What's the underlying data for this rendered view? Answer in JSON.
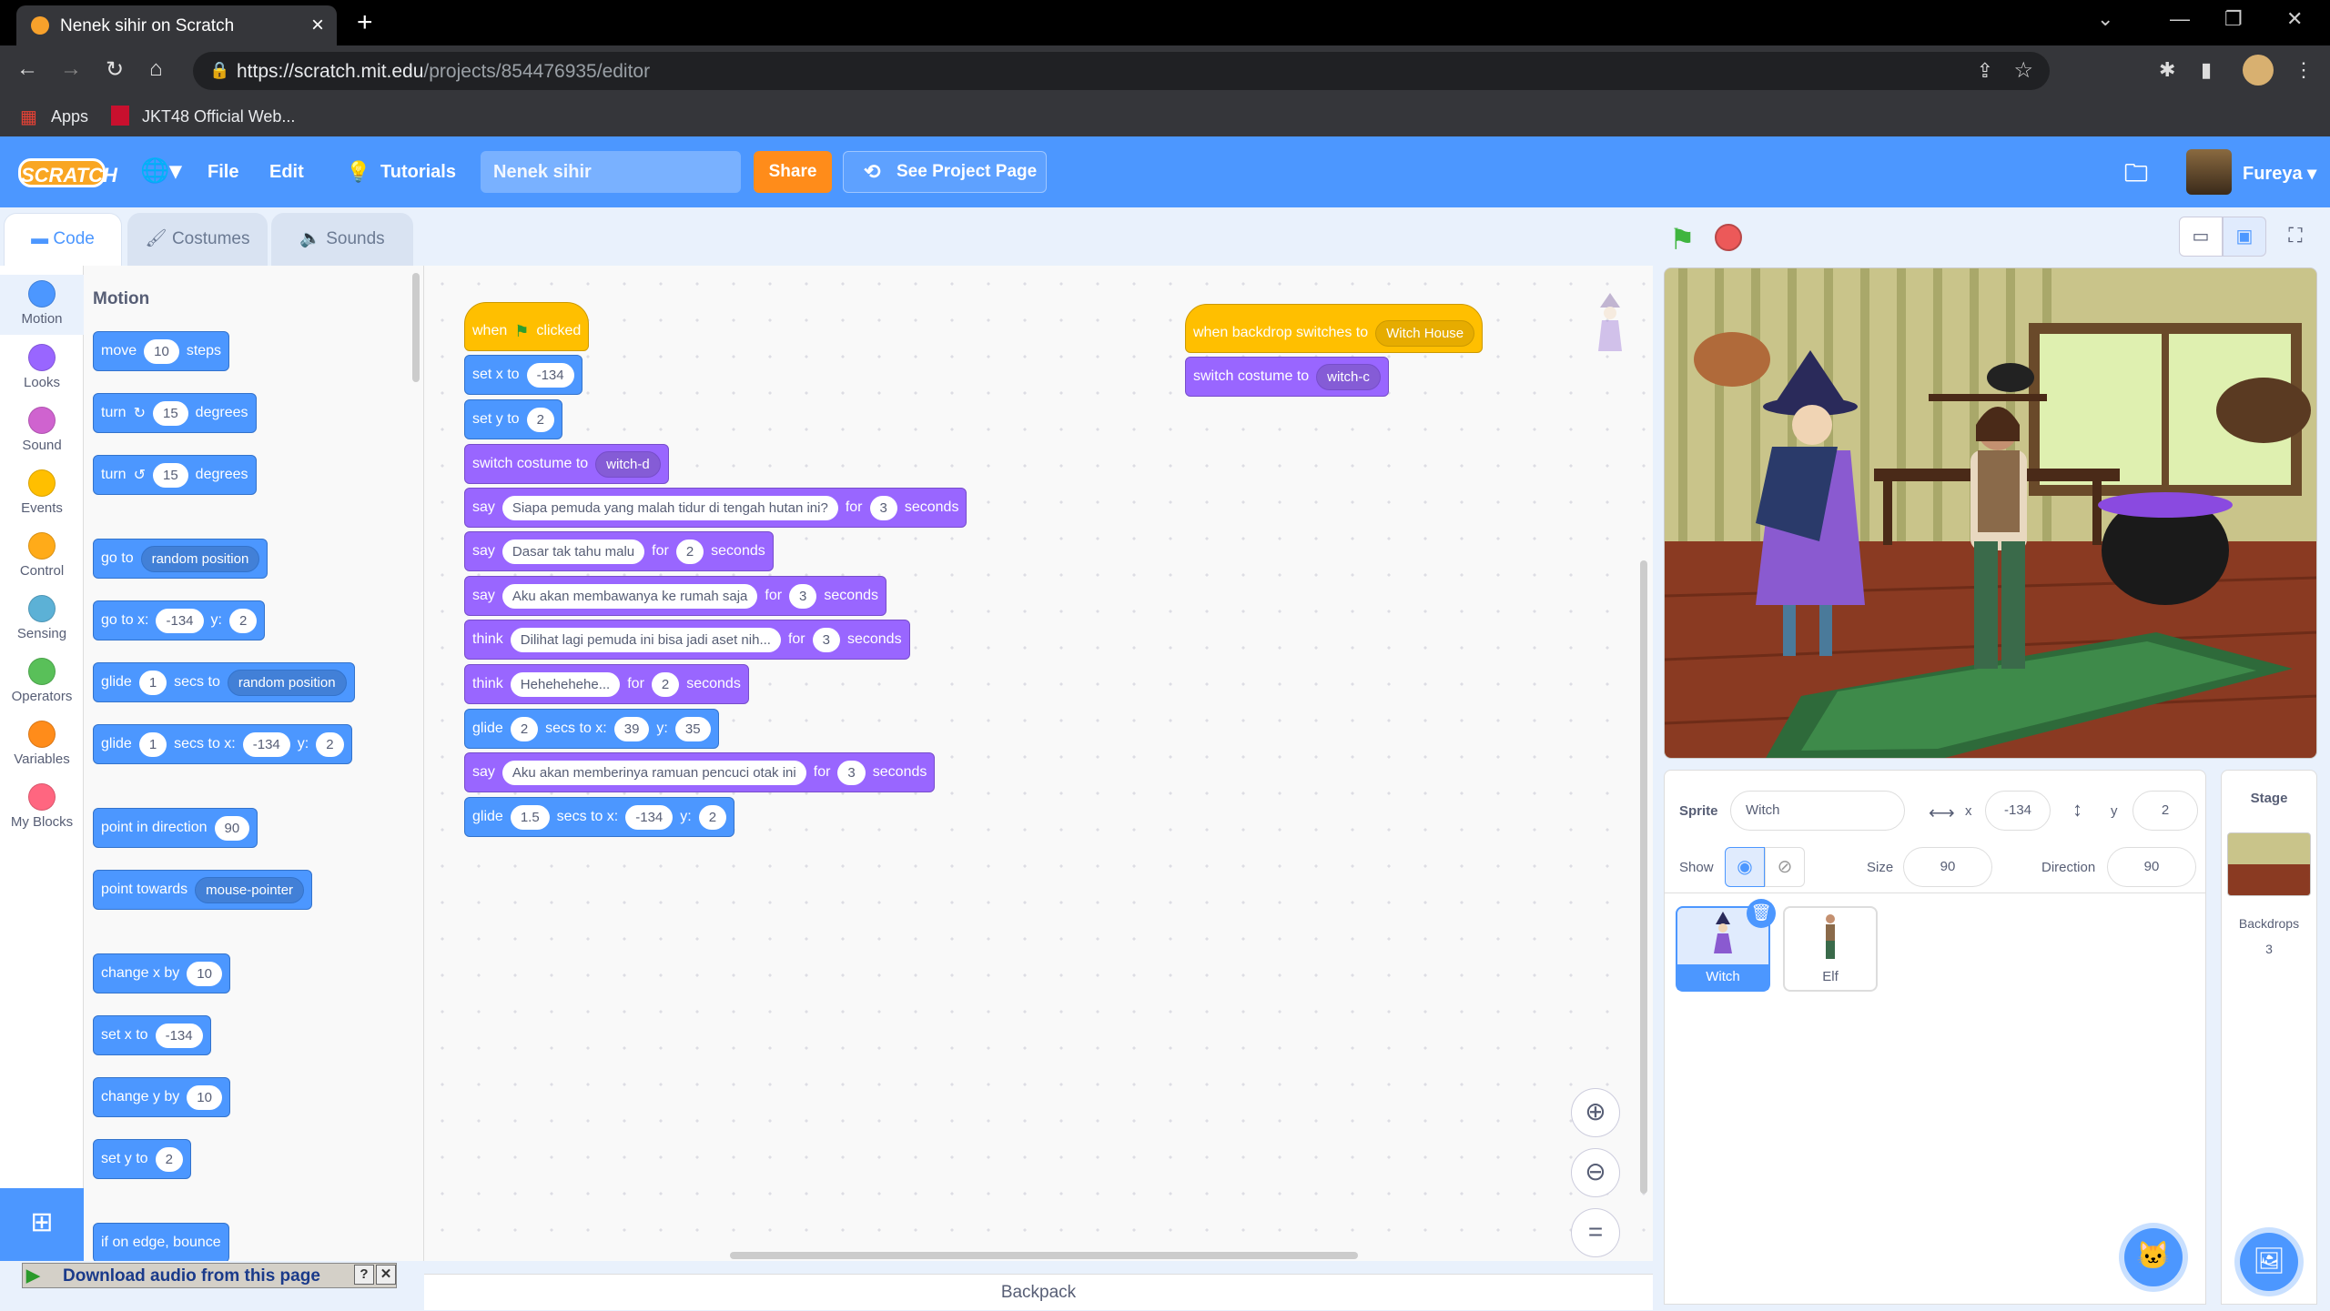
{
  "browser": {
    "tab_title": "Nenek sihir on Scratch",
    "url_host": "https://scratch.mit.edu",
    "url_path": "/projects/854476935/editor",
    "bookmarks": [
      "Apps",
      "JKT48 Official Web..."
    ]
  },
  "menubar": {
    "logo": "SCRATCH",
    "file": "File",
    "edit": "Edit",
    "tutorials": "Tutorials",
    "project_title": "Nenek sihir",
    "share": "Share",
    "see_project_page": "See Project Page",
    "username": "Fureya"
  },
  "tabs": {
    "code": "Code",
    "costumes": "Costumes",
    "sounds": "Sounds"
  },
  "categories": [
    {
      "label": "Motion",
      "color": "#4c97ff"
    },
    {
      "label": "Looks",
      "color": "#9966ff"
    },
    {
      "label": "Sound",
      "color": "#cf63cf"
    },
    {
      "label": "Events",
      "color": "#ffbf00"
    },
    {
      "label": "Control",
      "color": "#ffab19"
    },
    {
      "label": "Sensing",
      "color": "#5cb1d6"
    },
    {
      "label": "Operators",
      "color": "#59c059"
    },
    {
      "label": "Variables",
      "color": "#ff8c1a"
    },
    {
      "label": "My Blocks",
      "color": "#ff6680"
    }
  ],
  "palette": {
    "heading": "Motion",
    "move": [
      "move",
      "10",
      "steps"
    ],
    "turn_cw": [
      "turn",
      "15",
      "degrees"
    ],
    "turn_ccw": [
      "turn",
      "15",
      "degrees"
    ],
    "goto": [
      "go to",
      "random position"
    ],
    "gotoxy": [
      "go to x:",
      "-134",
      "y:",
      "2"
    ],
    "glide_to": [
      "glide",
      "1",
      "secs to",
      "random position"
    ],
    "glide_xy": [
      "glide",
      "1",
      "secs to x:",
      "-134",
      "y:",
      "2"
    ],
    "point_dir": [
      "point in direction",
      "90"
    ],
    "point_towards": [
      "point towards",
      "mouse-pointer"
    ],
    "change_x": [
      "change x by",
      "10"
    ],
    "set_x": [
      "set x to",
      "-134"
    ],
    "change_y": [
      "change y by",
      "10"
    ],
    "set_y": [
      "set y to",
      "2"
    ],
    "edge_bounce": "if on edge, bounce"
  },
  "script1": {
    "hat": [
      "when",
      "clicked"
    ],
    "set_x": [
      "set x to",
      "-134"
    ],
    "set_y": [
      "set y to",
      "2"
    ],
    "costume": [
      "switch costume to",
      "witch-d"
    ],
    "say1": [
      "say",
      "Siapa pemuda yang malah tidur di tengah hutan ini?",
      "for",
      "3",
      "seconds"
    ],
    "say2": [
      "say",
      "Dasar tak tahu malu",
      "for",
      "2",
      "seconds"
    ],
    "say3": [
      "say",
      "Aku akan membawanya ke rumah saja",
      "for",
      "3",
      "seconds"
    ],
    "think1": [
      "think",
      "Dilihat lagi pemuda ini bisa jadi aset nih...",
      "for",
      "3",
      "seconds"
    ],
    "think2": [
      "think",
      "Hehehehehe...",
      "for",
      "2",
      "seconds"
    ],
    "glide1": [
      "glide",
      "2",
      "secs to x:",
      "39",
      "y:",
      "35"
    ],
    "say4": [
      "say",
      "Aku akan memberinya ramuan pencuci otak ini",
      "for",
      "3",
      "seconds"
    ],
    "glide2": [
      "glide",
      "1.5",
      "secs to x:",
      "-134",
      "y:",
      "2"
    ]
  },
  "script2": {
    "hat": [
      "when backdrop switches to",
      "Witch House"
    ],
    "costume": [
      "switch costume to",
      "witch-c"
    ]
  },
  "sprite_info": {
    "sprite_label": "Sprite",
    "sprite_name": "Witch",
    "x_label": "x",
    "x": "-134",
    "y_label": "y",
    "y": "2",
    "show_label": "Show",
    "size_label": "Size",
    "size": "90",
    "direction_label": "Direction",
    "direction": "90"
  },
  "sprites": [
    "Witch",
    "Elf"
  ],
  "stage_panel": {
    "title": "Stage",
    "backdrops_label": "Backdrops",
    "backdrops_count": "3"
  },
  "backpack": "Backpack",
  "audio_bar": "Download audio from this page"
}
